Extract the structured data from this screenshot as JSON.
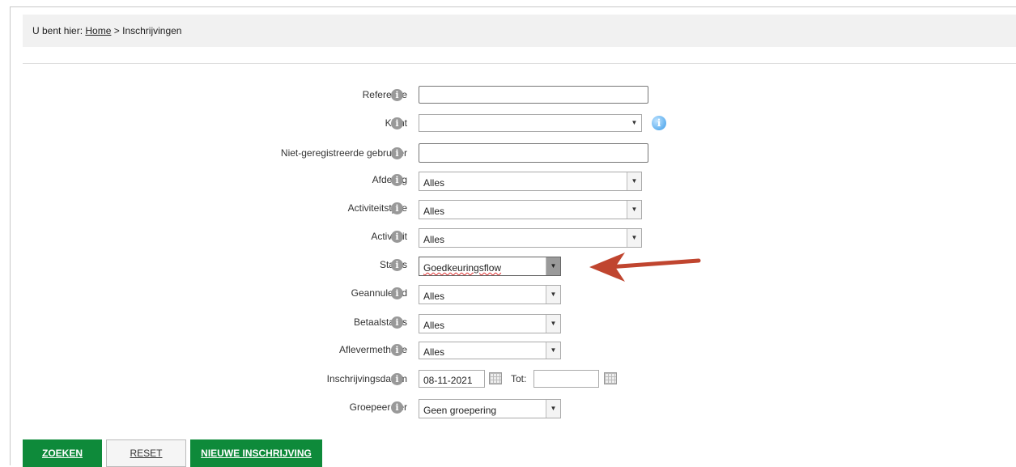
{
  "breadcrumb": {
    "prefix": "U bent hier:",
    "home": "Home",
    "separator": ">",
    "current": "Inschrijvingen"
  },
  "form": {
    "referentie": {
      "label": "Referentie",
      "value": ""
    },
    "klant": {
      "label": "Klant",
      "value": ""
    },
    "niet_geregistreerd": {
      "label": "Niet-geregistreerde gebruiker",
      "value": ""
    },
    "afdeling": {
      "label": "Afdeling",
      "value": "Alles"
    },
    "activiteitstype": {
      "label": "Activiteitstype",
      "value": "Alles"
    },
    "activiteit": {
      "label": "Activiteit",
      "value": "Alles"
    },
    "status": {
      "label": "Status",
      "value": "Goedkeuringsflow"
    },
    "geannuleerd": {
      "label": "Geannuleerd",
      "value": "Alles"
    },
    "betaalstatus": {
      "label": "Betaalstatus",
      "value": "Alles"
    },
    "aflevermethode": {
      "label": "Aflevermethode",
      "value": "Alles"
    },
    "inschrijvingsdatum": {
      "label": "Inschrijvingsdatum",
      "from": "08-11-2021",
      "tot_label": "Tot:",
      "to": ""
    },
    "groepeer_per": {
      "label": "Groepeer per",
      "value": "Geen groepering"
    }
  },
  "buttons": {
    "zoeken": "ZOEKEN",
    "reset": "RESET",
    "nieuwe": "NIEUWE INSCHRIJVING"
  },
  "icons": {
    "info": "i",
    "dropdown": "▼"
  },
  "colors": {
    "primary_button": "#0e8a3a",
    "annotation_arrow": "#c0452f",
    "info_blue": "#3a9be8"
  }
}
